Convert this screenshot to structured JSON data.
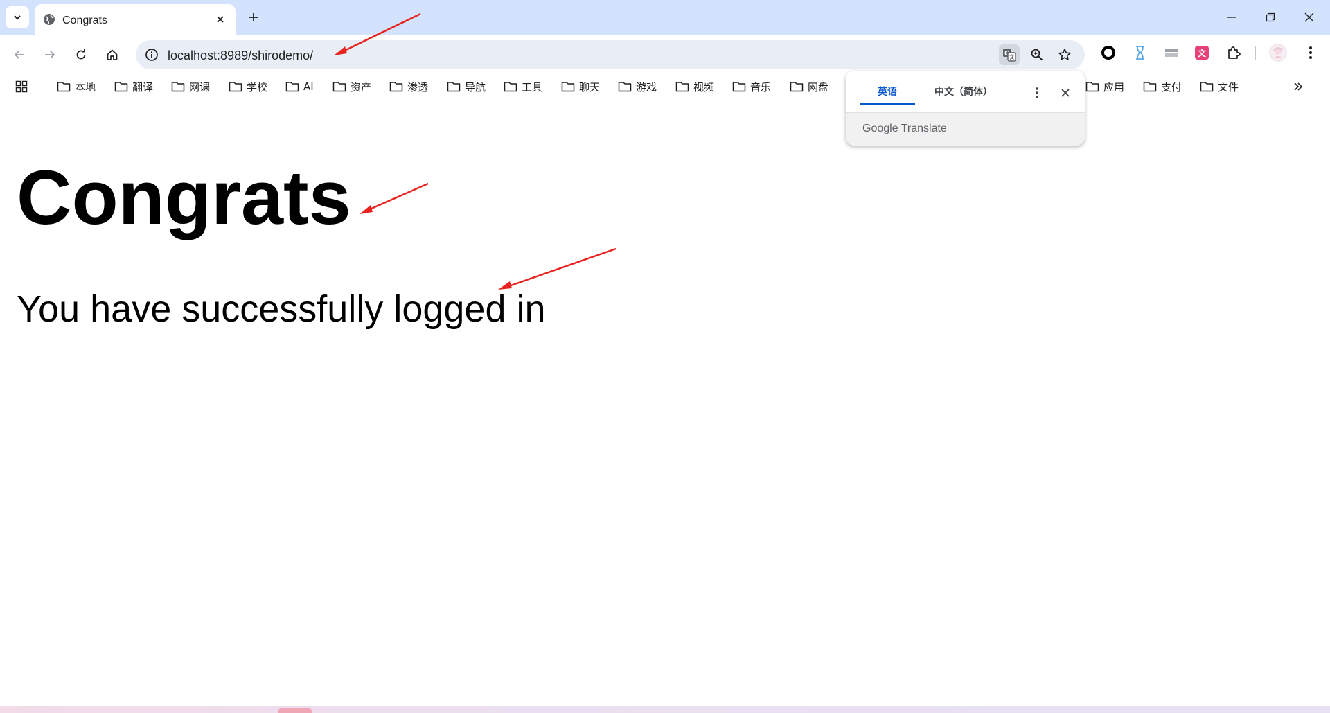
{
  "browser": {
    "tab": {
      "title": "Congrats"
    },
    "address_bar": {
      "host": "localhost",
      "port_path": ":8989/shirodemo/"
    }
  },
  "bookmarks": {
    "items": [
      {
        "label": "本地"
      },
      {
        "label": "翻译"
      },
      {
        "label": "网课"
      },
      {
        "label": "学校"
      },
      {
        "label": "AI"
      },
      {
        "label": "资产"
      },
      {
        "label": "渗透"
      },
      {
        "label": "导航"
      },
      {
        "label": "工具"
      },
      {
        "label": "聊天"
      },
      {
        "label": "游戏"
      },
      {
        "label": "视频"
      },
      {
        "label": "音乐"
      },
      {
        "label": "网盘"
      },
      {
        "label": "应用"
      },
      {
        "label": "支付"
      },
      {
        "label": "文件"
      }
    ]
  },
  "translate_popup": {
    "source_language": "英语",
    "target_language": "中文（简体）",
    "brand_google": "Google",
    "brand_translate": " Translate"
  },
  "page": {
    "heading": "Congrats",
    "message": "You have successfully logged in"
  },
  "annotation_color": "#e8231f",
  "icons": [
    "tab-search-icon",
    "globe-icon",
    "close-icon",
    "plus-icon",
    "minimize-icon",
    "restore-icon",
    "back-arrow-icon",
    "forward-arrow-icon",
    "reload-icon",
    "home-icon",
    "info-icon",
    "translate-icon",
    "zoom-icon",
    "star-icon",
    "folder-icon",
    "apps-grid-icon",
    "chevron-double-right-icon",
    "more-vert-icon",
    "puzzle-icon"
  ]
}
